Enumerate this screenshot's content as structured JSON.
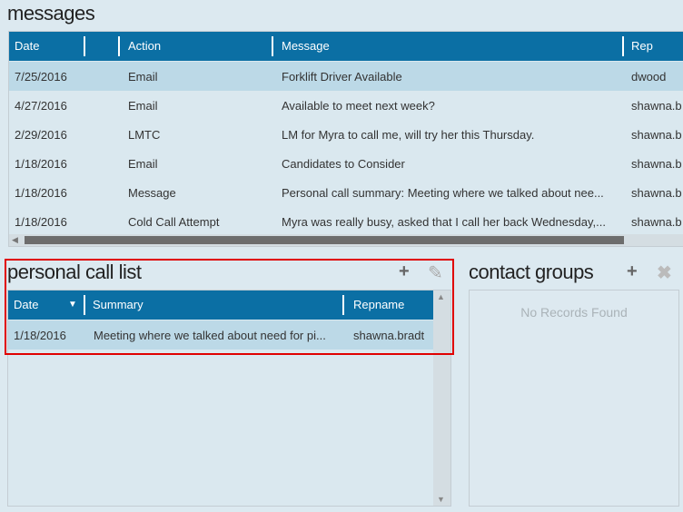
{
  "messages": {
    "title": "messages",
    "columns": [
      "Date",
      "Action",
      "Message",
      "Rep"
    ],
    "rows": [
      {
        "date": "7/25/2016",
        "action": "Email",
        "message": "Forklift Driver Available",
        "rep": "dwood"
      },
      {
        "date": "4/27/2016",
        "action": "Email",
        "message": "Available to meet next week?",
        "rep": "shawna.b"
      },
      {
        "date": "2/29/2016",
        "action": "LMTC",
        "message": "LM for Myra to call me, will try her this Thursday.",
        "rep": "shawna.b"
      },
      {
        "date": "1/18/2016",
        "action": "Email",
        "message": "Candidates to Consider",
        "rep": "shawna.b"
      },
      {
        "date": "1/18/2016",
        "action": "Message",
        "message": "Personal call summary: Meeting where we talked about nee...",
        "rep": "shawna.b"
      },
      {
        "date": "1/18/2016",
        "action": "Cold Call Attempt",
        "message": "Myra was really busy, asked that I call her back Wednesday,...",
        "rep": "shawna.b"
      }
    ]
  },
  "personal_call_list": {
    "title": "personal call list",
    "columns": [
      "Date",
      "Summary",
      "Repname"
    ],
    "rows": [
      {
        "date": "1/18/2016",
        "summary": "Meeting where we talked about need for pi...",
        "repname": "shawna.bradt"
      }
    ]
  },
  "contact_groups": {
    "title": "contact groups",
    "empty": "No Records Found"
  },
  "colors": {
    "header": "#0b6fa4",
    "selected_row": "#bcd9e7",
    "highlight_border": "#e00000"
  }
}
